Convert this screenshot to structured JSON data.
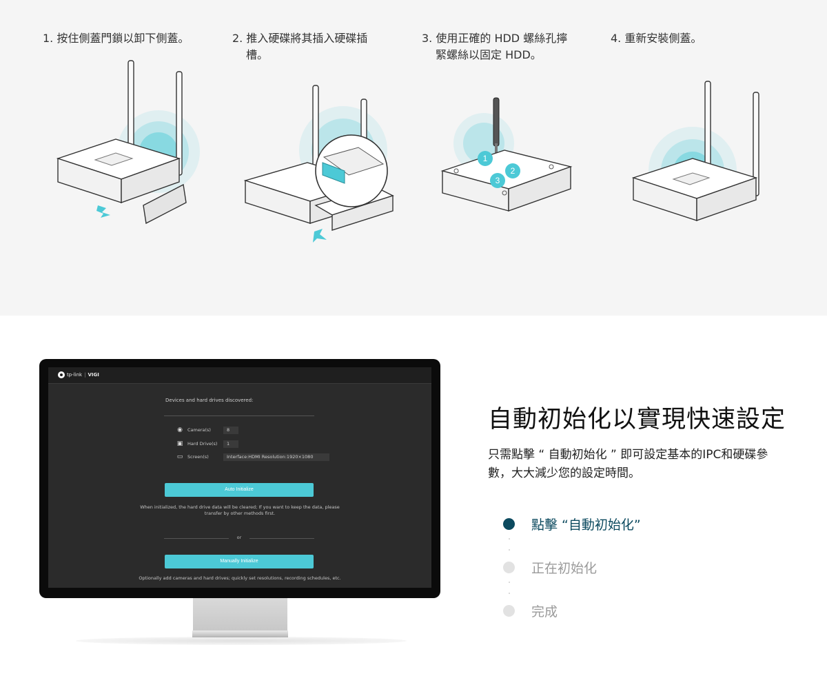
{
  "steps": [
    {
      "number": "1.",
      "line1": "按住側蓋門鎖以卸下側蓋。",
      "line2": ""
    },
    {
      "number": "2.",
      "line1": "推入硬碟將其插入硬碟插",
      "line2": "槽。"
    },
    {
      "number": "3.",
      "line1": "使用正確的 HDD 螺絲孔擰",
      "line2": "緊螺絲以固定 HDD。"
    },
    {
      "number": "4.",
      "line1": "重新安裝側蓋。",
      "line2": ""
    }
  ],
  "screw_markers": [
    "1",
    "2",
    "3"
  ],
  "colors": {
    "accent": "#4cc9d6",
    "dark_teal": "#0c4a5f",
    "step_bg": "#f5f5f5"
  },
  "nvr_ui": {
    "brand": "tp-link",
    "product": "VIGI",
    "title": "Devices and hard drives discovered:",
    "rows": [
      {
        "icon": "camera-icon",
        "label": "Camera(s)",
        "value": "8"
      },
      {
        "icon": "hard-drive-icon",
        "label": "Hard Drive(s)",
        "value": "1"
      },
      {
        "icon": "screen-icon",
        "label": "Screen(s)",
        "value": "Interface:HDMI Resolution:1920×1080"
      }
    ],
    "auto_button": "Auto Initialize",
    "auto_note_line1": "When initialized, the hard drive data will be cleared; If you want to keep the data, please",
    "auto_note_line2": "transfer by other methods first.",
    "or": "or",
    "manual_button": "Manually Initialize",
    "manual_note": "Optionally add cameras and hard drives; quickly set resolutions, recording schedules, etc."
  },
  "feature": {
    "title": "自動初始化以實現快速設定",
    "desc_line1": "只需點擊 “ 自動初始化 ” 即可設定基本的IPC和硬碟參",
    "desc_line2": "數，大大減少您的設定時間。"
  },
  "progress": [
    {
      "label": "點擊 “自動初始化”",
      "active": true
    },
    {
      "label": "正在初始化",
      "active": false
    },
    {
      "label": "完成",
      "active": false
    }
  ]
}
